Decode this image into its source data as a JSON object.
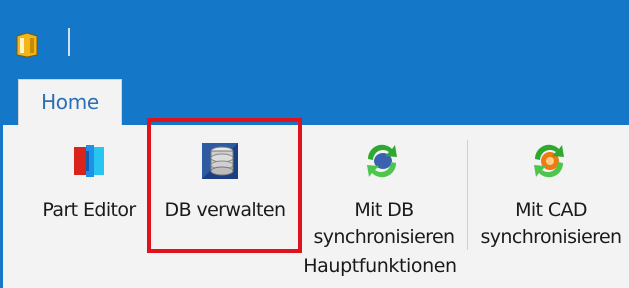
{
  "tabs": [
    {
      "label": "Home"
    }
  ],
  "ribbon": {
    "group_label": "Hauptfunktionen",
    "buttons": [
      {
        "label": "Part Editor",
        "icon": "part-editor-icon"
      },
      {
        "label": "DB verwalten",
        "icon": "database-icon"
      },
      {
        "label_line1": "Mit DB",
        "label_line2": "synchronisieren",
        "icon": "sync-db-icon"
      },
      {
        "label_line1": "Mit CAD",
        "label_line2": "synchronisieren",
        "icon": "sync-cad-icon"
      }
    ]
  },
  "colors": {
    "titlebar": "#1577c7",
    "ribbon_bg": "#f3f3f3",
    "tab_text": "#2b6fb6",
    "highlight": "#e0121c"
  }
}
